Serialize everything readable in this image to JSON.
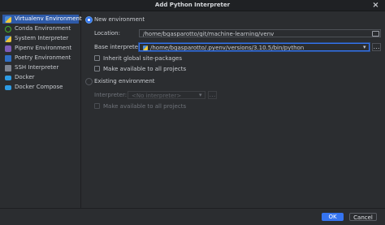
{
  "window": {
    "title": "Add Python Interpreter",
    "close_glyph": "×"
  },
  "sidebar": {
    "items": [
      {
        "label": "Virtualenv Environment",
        "icon": "virtualenv-icon",
        "selected": true
      },
      {
        "label": "Conda Environment",
        "icon": "conda-icon"
      },
      {
        "label": "System Interpreter",
        "icon": "python-icon"
      },
      {
        "label": "Pipenv Environment",
        "icon": "pipenv-icon"
      },
      {
        "label": "Poetry Environment",
        "icon": "poetry-icon"
      },
      {
        "label": "SSH Interpreter",
        "icon": "ssh-icon"
      },
      {
        "label": "Docker",
        "icon": "docker-icon"
      },
      {
        "label": "Docker Compose",
        "icon": "docker-compose-icon"
      }
    ]
  },
  "new_env": {
    "radio_label": "New environment",
    "selected": true,
    "location_label": "Location:",
    "location_value": "/home/bgasparotto/git/machine-learning/venv",
    "base_label": "Base interpreter:",
    "base_value": "/home/bgasparotto/.pyenv/versions/3.10.5/bin/python",
    "dropdown_glyph": "▾",
    "browse_glyph": "…",
    "inherit_label": "Inherit global site-packages",
    "available_label": "Make available to all projects"
  },
  "existing_env": {
    "radio_label": "Existing environment",
    "selected": false,
    "interpreter_label": "Interpreter:",
    "interpreter_value": "<No interpreter>",
    "dropdown_glyph": "▾",
    "browse_glyph": "…",
    "available_label": "Make available to all projects"
  },
  "footer": {
    "ok_label": "OK",
    "cancel_label": "Cancel"
  },
  "colors": {
    "accent": "#3574f0",
    "background": "#2b2d30",
    "selection": "#2e5aa8"
  }
}
